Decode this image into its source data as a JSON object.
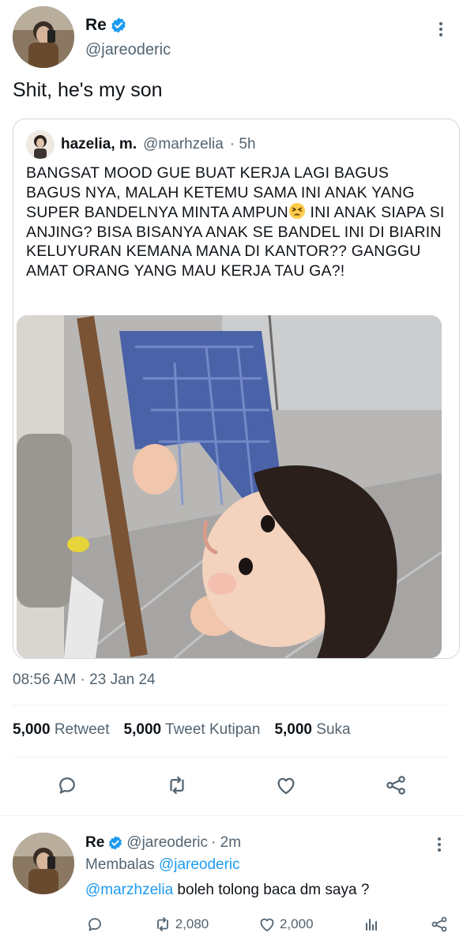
{
  "tweet": {
    "author_name": "Re",
    "author_handle": "@jareoderic",
    "text": "Shit, he's my son",
    "timestamp": "08:56 AM · 23 Jan 24"
  },
  "quote": {
    "name": "hazelia, m.",
    "handle": "@marhzelia",
    "time": "· 5h",
    "text_before_emoji": "BANGSAT MOOD GUE BUAT KERJA LAGI BAGUS BAGUS NYA, MALAH KETEMU SAMA INI ANAK YANG SUPER BANDELNYA MINTA AMPUN",
    "text_after_emoji": " INI ANAK SIAPA SI ANJING? BISA BISANYA ANAK SE BANDEL INI DI BIARIN KELUYURAN KEMANA MANA DI KANTOR?? GANGGU AMAT ORANG YANG MAU KERJA TAU GA?!",
    "emoji_icon": "tired-face-emoji"
  },
  "stats": {
    "retweets_count": "5,000",
    "retweets_label": "Retweet",
    "quotes_count": "5,000",
    "quotes_label": "Tweet Kutipan",
    "likes_count": "5,000",
    "likes_label": "Suka"
  },
  "actions": [
    "reply-icon",
    "retweet-icon",
    "like-icon",
    "share-icon"
  ],
  "reply": {
    "author_name": "Re",
    "author_handle": "@jareoderic",
    "time": "· 2m",
    "replying_label": "Membalas",
    "replying_to": "@jareoderic",
    "mention": "@marzhzelia",
    "text": " boleh tolong baca dm saya ?",
    "retweet_count": "2,080",
    "like_count": "2,000"
  },
  "colors": {
    "accent": "#1d9bf0",
    "text": "#0f1419",
    "muted": "#536471",
    "border": "#cfd9de"
  }
}
